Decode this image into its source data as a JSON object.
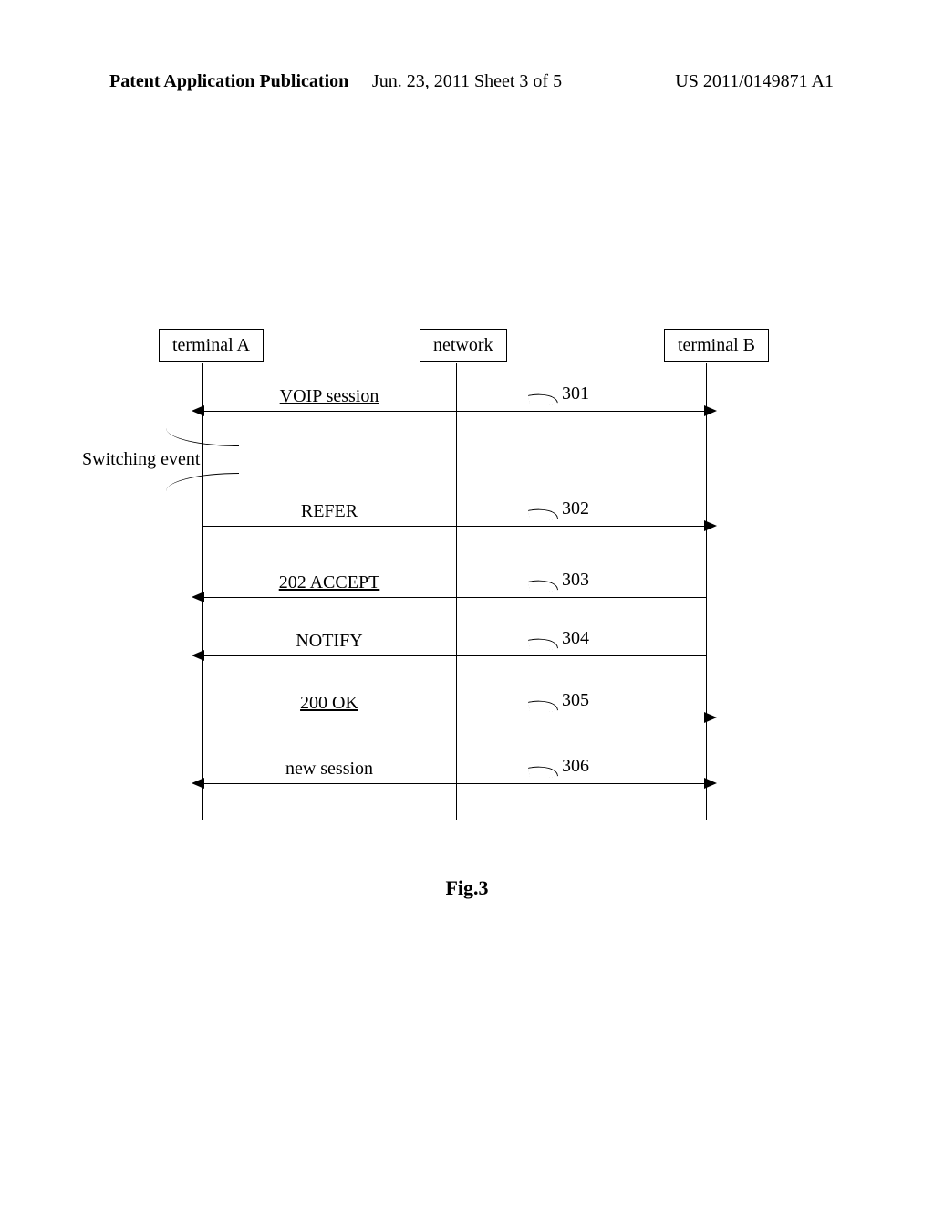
{
  "header": {
    "left": "Patent Application Publication",
    "center": "Jun. 23, 2011  Sheet 3 of 5",
    "right": "US 2011/0149871 A1"
  },
  "actors": {
    "a": "terminal A",
    "net": "network",
    "b": "terminal B"
  },
  "event": {
    "label": "Switching event"
  },
  "messages": {
    "m1": {
      "label": "VOIP session",
      "ref": "301"
    },
    "m2": {
      "label": "REFER",
      "ref": "302"
    },
    "m3": {
      "label": "202 ACCEPT",
      "ref": "303"
    },
    "m4": {
      "label": "NOTIFY",
      "ref": "304"
    },
    "m5": {
      "label": "200 OK",
      "ref": "305"
    },
    "m6": {
      "label": "new session",
      "ref": "306"
    }
  },
  "figure": {
    "caption": "Fig.3"
  }
}
